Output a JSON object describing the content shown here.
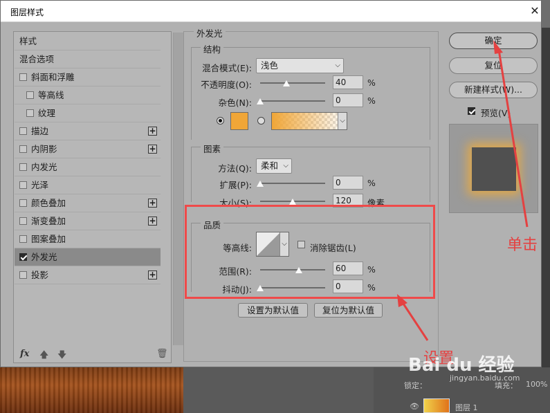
{
  "dialog": {
    "title": "图层样式"
  },
  "style_list": {
    "header": "样式",
    "blend_options": "混合选项",
    "items": [
      {
        "label": "斜面和浮雕",
        "checked": false,
        "plus": false,
        "indent": false
      },
      {
        "label": "等高线",
        "checked": false,
        "plus": false,
        "indent": true
      },
      {
        "label": "纹理",
        "checked": false,
        "plus": false,
        "indent": true
      },
      {
        "label": "描边",
        "checked": false,
        "plus": true,
        "indent": false
      },
      {
        "label": "内阴影",
        "checked": false,
        "plus": true,
        "indent": false
      },
      {
        "label": "内发光",
        "checked": false,
        "plus": false,
        "indent": false
      },
      {
        "label": "光泽",
        "checked": false,
        "plus": false,
        "indent": false
      },
      {
        "label": "颜色叠加",
        "checked": false,
        "plus": true,
        "indent": false
      },
      {
        "label": "渐变叠加",
        "checked": false,
        "plus": true,
        "indent": false
      },
      {
        "label": "图案叠加",
        "checked": false,
        "plus": false,
        "indent": false
      },
      {
        "label": "外发光",
        "checked": true,
        "plus": false,
        "indent": false,
        "selected": true
      },
      {
        "label": "投影",
        "checked": false,
        "plus": true,
        "indent": false
      }
    ],
    "fx_label": "fx"
  },
  "outer_glow": {
    "title": "外发光",
    "structure": {
      "title": "结构",
      "blend_mode_label": "混合模式(E):",
      "blend_mode_value": "浅色",
      "opacity_label": "不透明度(O):",
      "opacity_value": "40",
      "opacity_unit": "%",
      "opacity_level": 40,
      "noise_label": "杂色(N):",
      "noise_value": "0",
      "noise_unit": "%",
      "noise_level": 0,
      "glow_color": "#f0a637"
    },
    "elements": {
      "title": "图素",
      "technique_label": "方法(Q):",
      "technique_value": "柔和",
      "spread_label": "扩展(P):",
      "spread_value": "0",
      "spread_unit": "%",
      "spread_level": 0,
      "size_label": "大小(S):",
      "size_value": "120",
      "size_unit": "像素",
      "size_level": 0.5
    },
    "quality": {
      "title": "品质",
      "contour_label": "等高线:",
      "antialias_label": "消除锯齿(L)",
      "antialias_checked": false,
      "range_label": "范围(R):",
      "range_value": "60",
      "range_unit": "%",
      "range_level": 60,
      "jitter_label": "抖动(J):",
      "jitter_value": "0",
      "jitter_unit": "%",
      "jitter_level": 0
    },
    "set_default": "设置为默认值",
    "reset_default": "复位为默认值"
  },
  "buttons": {
    "ok": "确定",
    "reset": "复位",
    "new_style": "新建样式(W)...",
    "preview_label": "预览(V)",
    "preview_checked": true
  },
  "annotations": {
    "click": "单击",
    "set": "设置",
    "color": "#e44141"
  },
  "layers_panel": {
    "lock_label": "锁定：",
    "fill_label": "填充：",
    "fill_value": "100%",
    "layer_name": "图层 1"
  },
  "watermark": {
    "text": "Bai du 经验",
    "sub": "jingyan.baidu.com"
  }
}
